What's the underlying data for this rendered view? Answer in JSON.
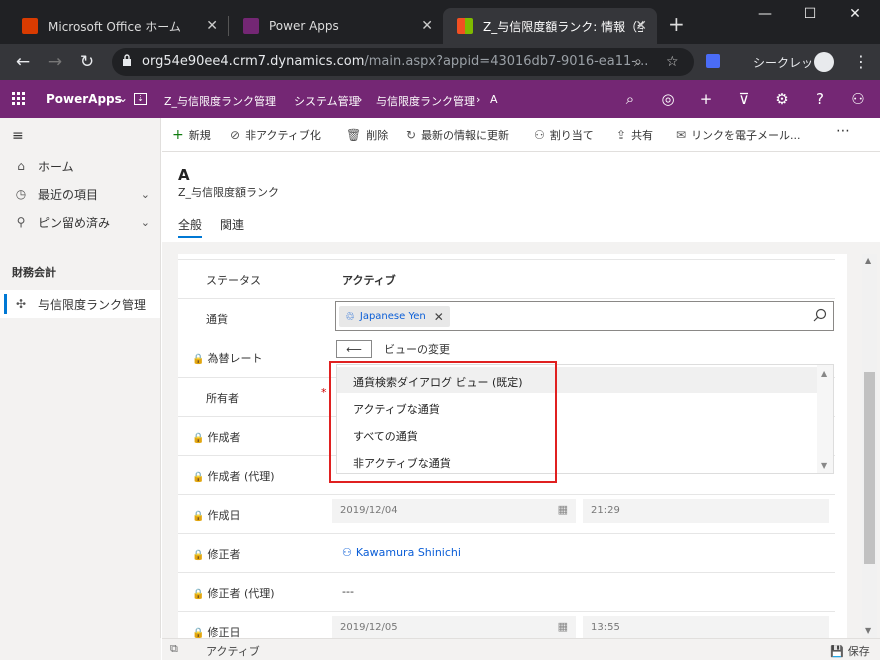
{
  "browser": {
    "tabs": [
      {
        "title": "Microsoft Office ホーム",
        "icon": "office-icon"
      },
      {
        "title": "Power Apps",
        "icon": "powerapps-icon"
      },
      {
        "title": "Z_与信限度額ランク: 情報（全",
        "icon": "dynamics-icon"
      }
    ],
    "url_host": "org54e90ee4.crm7.dynamics.com",
    "url_rest": "/main.aspx?appid=43016db7-9016-ea11-...",
    "incognito_label": "シークレット"
  },
  "app_header": {
    "brand": "PowerApps",
    "app_name": "Z_与信限度ランク管理",
    "crumbs": [
      "システム管理",
      "与信限度ランク管理",
      "A"
    ]
  },
  "sidebar": {
    "items": [
      {
        "label": "ホーム",
        "icon": "home-icon"
      },
      {
        "label": "最近の項目",
        "icon": "clock-icon"
      },
      {
        "label": "ピン留め済み",
        "icon": "pin-icon"
      }
    ],
    "group_title": "財務会計",
    "entity_item": "与信限度ランク管理"
  },
  "commands": [
    {
      "label": "新規",
      "icon": "plus-icon"
    },
    {
      "label": "非アクティブ化",
      "icon": "deactivate-icon"
    },
    {
      "label": "削除",
      "icon": "trash-icon"
    },
    {
      "label": "最新の情報に更新",
      "icon": "refresh-icon"
    },
    {
      "label": "割り当て",
      "icon": "assign-icon"
    },
    {
      "label": "共有",
      "icon": "share-icon"
    },
    {
      "label": "リンクを電子メール...",
      "icon": "email-icon"
    }
  ],
  "record": {
    "title": "A",
    "entity": "Z_与信限度額ランク",
    "tabs": [
      "全般",
      "関連"
    ]
  },
  "form": {
    "status_label": "ステータス",
    "status_value": "アクティブ",
    "currency_label": "通貨",
    "currency_value": "Japanese Yen",
    "exchange_label": "為替レート",
    "change_view_label": "ビューの変更",
    "views": [
      "通貨検索ダイアログ ビュー (既定)",
      "アクティブな通貨",
      "すべての通貨",
      "非アクティブな通貨"
    ],
    "owner_label": "所有者",
    "owner_required": "*",
    "created_by_label": "作成者",
    "created_by_proxy_label": "作成者 (代理)",
    "created_on_label": "作成日",
    "created_on_date": "2019/12/04",
    "created_on_time": "21:29",
    "modified_by_label": "修正者",
    "modified_by_value": "Kawamura Shinichi",
    "modified_by_proxy_label": "修正者 (代理)",
    "modified_by_proxy_value": "---",
    "modified_on_label": "修正日",
    "modified_on_date": "2019/12/05",
    "modified_on_time": "13:55"
  },
  "footer": {
    "status": "アクティブ",
    "save": "保存"
  },
  "colors": {
    "app_header": "#742774",
    "highlight_box": "#e02020",
    "link": "#0b5ed7"
  }
}
